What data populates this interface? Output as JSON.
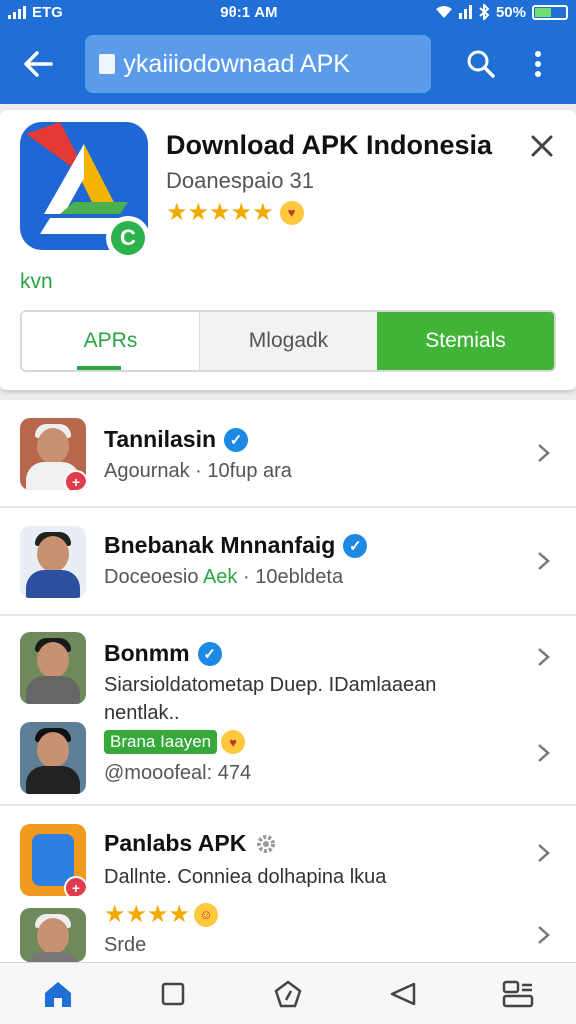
{
  "status_bar": {
    "carrier": "EΤG",
    "time": "9θ:1 AM",
    "battery": "50%",
    "battery_level": 0.5
  },
  "app_bar": {
    "search_value": "ykaiiiodownaad APK"
  },
  "icons": {
    "back": "back-arrow-icon",
    "search": "search-icon",
    "more": "more-vert-icon",
    "close": "close-icon"
  },
  "card": {
    "title": "Download APK Indonesia",
    "subtitle": "Doanespaio  31",
    "rating_stars": "★★★★★",
    "label": "kvn",
    "segments": [
      "APRs",
      "Mlogadk",
      "Stemials"
    ]
  },
  "list": [
    {
      "title": "Tannilasin",
      "subtitle": "Agournak · 10fup ara"
    },
    {
      "title": "Bnebanak Mnnanfaig",
      "subtitle_pre": "Doceoesio ",
      "subtitle_green": "Aek",
      "subtitle_post": " · 10ebldeta"
    },
    {
      "title": "Bonmm",
      "line1": "Siarsioldatometap Duep. IDamlaaean",
      "line2": "nentlak..",
      "pill": "Brana Iaayen",
      "handle": "@mooofeal: 474"
    },
    {
      "title": "Panlabs APK",
      "line1": "Dallnte. Conniea dolhapina lkua",
      "rating_stars": "★★★★",
      "tail": "Srde"
    }
  ],
  "colors": {
    "primary": "#1f6fd6",
    "accent_green": "#41b336",
    "star": "#f2a900",
    "verified": "#1e88e5"
  },
  "bottom_nav": [
    "home-icon",
    "square-icon",
    "pentagon-icon",
    "back-triangle-icon",
    "profile-list-icon"
  ]
}
